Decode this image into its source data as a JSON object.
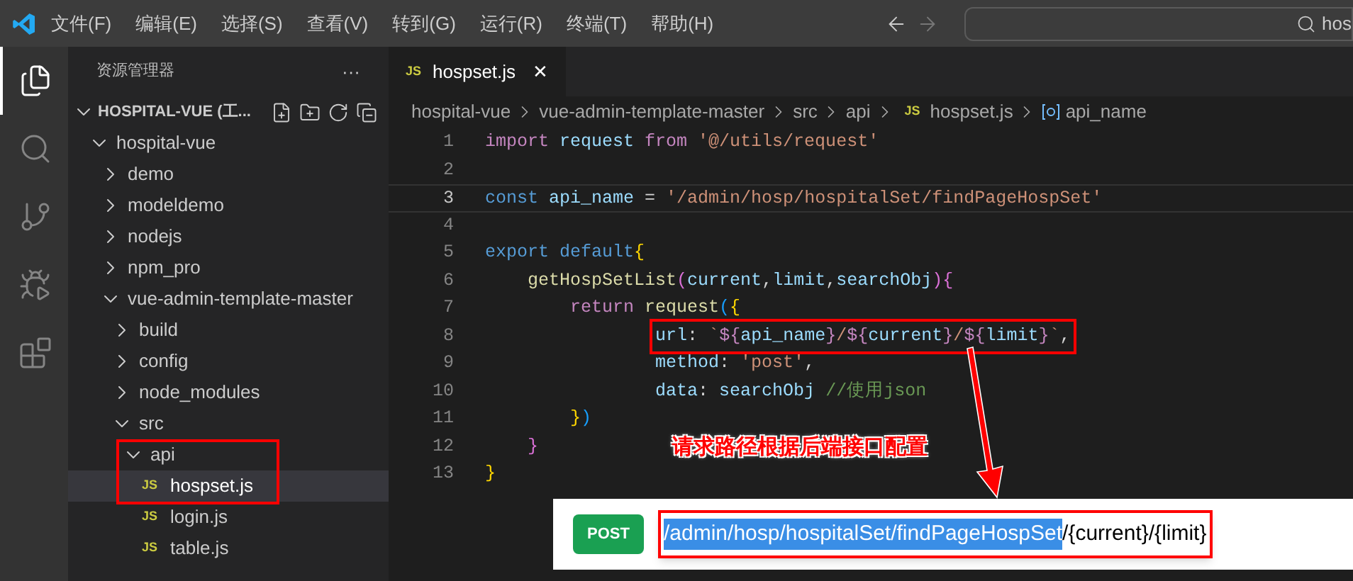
{
  "menu": [
    "文件(F)",
    "编辑(E)",
    "选择(S)",
    "查看(V)",
    "转到(G)",
    "运行(R)",
    "终端(T)",
    "帮助(H)"
  ],
  "search": {
    "value": "hos"
  },
  "activity_bar": [
    {
      "kind": "explorer",
      "selected": true
    },
    {
      "kind": "search",
      "selected": false
    },
    {
      "kind": "scm",
      "selected": false
    },
    {
      "kind": "debug",
      "selected": false
    },
    {
      "kind": "extensions",
      "selected": false
    }
  ],
  "sidebar": {
    "title": "资源管理器",
    "more": "···",
    "section": "HOSPITAL-VUE (工...",
    "tree": [
      {
        "label": "hospital-vue",
        "kind": "folder",
        "expanded": true,
        "selected": false,
        "children": [
          {
            "label": "demo",
            "kind": "folder",
            "expanded": false,
            "selected": false
          },
          {
            "label": "modeldemo",
            "kind": "folder",
            "expanded": false,
            "selected": false
          },
          {
            "label": "nodejs",
            "kind": "folder",
            "expanded": false,
            "selected": false
          },
          {
            "label": "npm_pro",
            "kind": "folder",
            "expanded": false,
            "selected": false
          },
          {
            "label": "vue-admin-template-master",
            "kind": "folder",
            "expanded": true,
            "selected": false,
            "children": [
              {
                "label": "build",
                "kind": "folder",
                "expanded": false,
                "selected": false
              },
              {
                "label": "config",
                "kind": "folder",
                "expanded": false,
                "selected": false
              },
              {
                "label": "node_modules",
                "kind": "folder",
                "expanded": false,
                "selected": false
              },
              {
                "label": "src",
                "kind": "folder",
                "expanded": true,
                "selected": false,
                "children": [
                  {
                    "label": "api",
                    "kind": "folder",
                    "expanded": true,
                    "selected": false,
                    "children": [
                      {
                        "label": "hospset.js",
                        "kind": "file",
                        "badge": "JS",
                        "selected": true
                      },
                      {
                        "label": "login.js",
                        "kind": "file",
                        "badge": "JS",
                        "selected": false
                      },
                      {
                        "label": "table.js",
                        "kind": "file",
                        "badge": "JS",
                        "selected": false
                      }
                    ]
                  }
                ]
              }
            ]
          }
        ]
      }
    ]
  },
  "tabs": [
    {
      "label": "hospset.js",
      "badge": "JS",
      "close": "✕",
      "selected": true
    }
  ],
  "breadcrumb": [
    {
      "label": "hospital-vue",
      "kind": "folder"
    },
    {
      "label": "vue-admin-template-master",
      "kind": "folder"
    },
    {
      "label": "src",
      "kind": "folder"
    },
    {
      "label": "api",
      "kind": "folder"
    },
    {
      "label": "hospset.js",
      "kind": "file",
      "badge": "JS"
    },
    {
      "label": "api_name",
      "kind": "symbol"
    }
  ],
  "code": [
    {
      "n": "1",
      "current": false,
      "kind": "normal",
      "tokens": [
        {
          "text": "import ",
          "kind": "kw"
        },
        {
          "text": "request ",
          "kind": "var"
        },
        {
          "text": "from ",
          "kind": "kw"
        },
        {
          "text": "'@/utils/request'",
          "kind": "str"
        }
      ]
    },
    {
      "n": "2",
      "current": false,
      "kind": "blank"
    },
    {
      "n": "3",
      "current": true,
      "kind": "normal",
      "tokens": [
        {
          "text": "const ",
          "kind": "decl"
        },
        {
          "text": "api_name ",
          "kind": "var"
        },
        {
          "text": "= ",
          "kind": "plain"
        },
        {
          "text": "'/admin/hosp/hospitalSet/findPageHospSet'",
          "kind": "str"
        }
      ]
    },
    {
      "n": "4",
      "current": false,
      "kind": "blank"
    },
    {
      "n": "5",
      "current": false,
      "kind": "normal",
      "tokens": [
        {
          "text": "export ",
          "kind": "decl"
        },
        {
          "text": "default",
          "kind": "decl"
        },
        {
          "text": "{",
          "kind": "b1"
        }
      ],
      "children": [
        {
          "n": "6",
          "current": false,
          "kind": "normal",
          "tokens": [
            {
              "text": "getHospSetList",
              "kind": "fn"
            },
            {
              "text": "(",
              "kind": "b2"
            },
            {
              "text": "current",
              "kind": "var"
            },
            {
              "text": ",",
              "kind": "plain"
            },
            {
              "text": "limit",
              "kind": "var"
            },
            {
              "text": ",",
              "kind": "plain"
            },
            {
              "text": "searchObj",
              "kind": "var"
            },
            {
              "text": ")",
              "kind": "b2"
            },
            {
              "text": "{",
              "kind": "b2"
            }
          ],
          "children": [
            {
              "n": "7",
              "current": false,
              "kind": "normal",
              "tokens": [
                {
                  "text": "return ",
                  "kind": "kw"
                },
                {
                  "text": "request",
                  "kind": "fn"
                },
                {
                  "text": "(",
                  "kind": "b3"
                },
                {
                  "text": "{",
                  "kind": "b1"
                }
              ],
              "children": [
                {
                  "n": "8",
                  "current": false,
                  "kind": "boxed",
                  "tokens": [
                    {
                      "text": "url",
                      "kind": "var"
                    },
                    {
                      "text": ": ",
                      "kind": "plain"
                    },
                    {
                      "text": "`",
                      "kind": "str"
                    },
                    {
                      "text": "${",
                      "kind": "kw"
                    },
                    {
                      "text": "api_name",
                      "kind": "var"
                    },
                    {
                      "text": "}",
                      "kind": "kw"
                    },
                    {
                      "text": "/",
                      "kind": "str"
                    },
                    {
                      "text": "${",
                      "kind": "kw"
                    },
                    {
                      "text": "current",
                      "kind": "var"
                    },
                    {
                      "text": "}",
                      "kind": "kw"
                    },
                    {
                      "text": "/",
                      "kind": "str"
                    },
                    {
                      "text": "${",
                      "kind": "kw"
                    },
                    {
                      "text": "limit",
                      "kind": "var"
                    },
                    {
                      "text": "}",
                      "kind": "kw"
                    },
                    {
                      "text": "`",
                      "kind": "str"
                    },
                    {
                      "text": ",",
                      "kind": "plain"
                    }
                  ]
                },
                {
                  "n": "9",
                  "current": false,
                  "kind": "normal",
                  "tokens": [
                    {
                      "text": "method",
                      "kind": "var"
                    },
                    {
                      "text": ": ",
                      "kind": "plain"
                    },
                    {
                      "text": "'post'",
                      "kind": "str"
                    },
                    {
                      "text": ",",
                      "kind": "plain"
                    }
                  ]
                },
                {
                  "n": "10",
                  "current": false,
                  "kind": "normal",
                  "tokens": [
                    {
                      "text": "data",
                      "kind": "var"
                    },
                    {
                      "text": ": ",
                      "kind": "plain"
                    },
                    {
                      "text": "searchObj ",
                      "kind": "var"
                    },
                    {
                      "text": "//使用json",
                      "kind": "comment"
                    }
                  ]
                }
              ]
            },
            {
              "n": "11",
              "current": false,
              "kind": "normal",
              "tokens": [
                {
                  "text": "}",
                  "kind": "b1"
                },
                {
                  "text": ")",
                  "kind": "b3"
                }
              ]
            }
          ]
        },
        {
          "n": "12",
          "current": false,
          "kind": "normal",
          "tokens": [
            {
              "text": "}",
              "kind": "b2"
            }
          ]
        }
      ]
    },
    {
      "n": "13",
      "current": false,
      "kind": "normal",
      "tokens": [
        {
          "text": "}",
          "kind": "b1"
        }
      ]
    }
  ],
  "annotation": {
    "text": "请求路径根据后端接口配置"
  },
  "swagger": {
    "method": "POST",
    "path": [
      {
        "text": "/admin/hosp/hospitalSet/findPageHospSet",
        "selected": true
      },
      {
        "text": "/{current}/{limit}",
        "selected": false
      }
    ]
  }
}
